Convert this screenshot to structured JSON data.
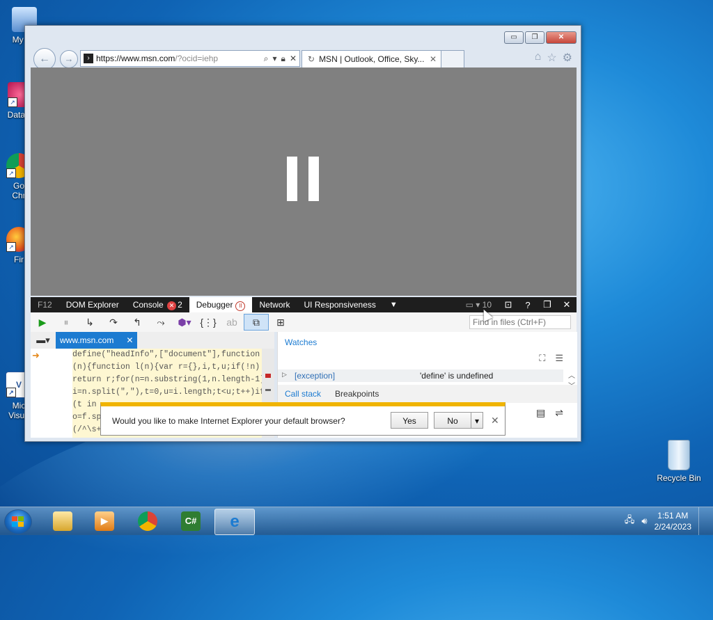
{
  "desktop": {
    "icons": [
      {
        "label": "My Co",
        "icon": "computer-icon"
      },
      {
        "label": "DataW",
        "icon": "datawindow-icon"
      },
      {
        "label": "Go",
        "label2": "Chr",
        "icon": "chrome-icon"
      },
      {
        "label": "Fir",
        "icon": "firefox-icon"
      },
      {
        "label": "Mic",
        "label2": "Visua",
        "icon": "visual-studio-icon"
      },
      {
        "label": "Recycle Bin",
        "icon": "recycle-bin-icon"
      }
    ]
  },
  "browser": {
    "url_host": "https://www.msn.com",
    "url_rest": "/?ocid=iehp",
    "tab_title": "MSN | Outlook, Office, Sky...",
    "window_buttons": {
      "minimize": "▭",
      "restore": "❐",
      "close": "✕"
    }
  },
  "devtools": {
    "tabs": {
      "f12": "F12",
      "dom": "DOM Explorer",
      "console": "Console",
      "console_errors": "2",
      "debugger": "Debugger",
      "network": "Network",
      "ui": "UI Responsiveness",
      "emulation_count": "10"
    },
    "find_placeholder": "Find in files (Ctrl+F)",
    "file_tab": "www.msn.com",
    "code_lines": [
      "define(\"headInfo\",[\"document\"],function",
      "(n){function l(n){var r={},i,t,u;if(!n)",
      "return r;for(n=n.substring(1,n.length-1),",
      "i=n.split(\",\"),t=0,u=i.length;t<u;t++)if",
      "(t in",
      "o=f.sp",
      "(/^\\s+"
    ],
    "watches_title": "Watches",
    "watch": {
      "name": "[exception]",
      "value": "'define' is undefined"
    },
    "subtabs": {
      "callstack": "Call stack",
      "breakpoints": "Breakpoints"
    }
  },
  "notification": {
    "message": "Would you like to make Internet Explorer your default browser?",
    "yes": "Yes",
    "no": "No"
  },
  "taskbar": {
    "time": "1:51 AM",
    "date": "2/24/2023"
  },
  "colors": {
    "accent": "#1c7bd1",
    "notify_bar": "#f0b400",
    "error_badge": "#e04343"
  }
}
